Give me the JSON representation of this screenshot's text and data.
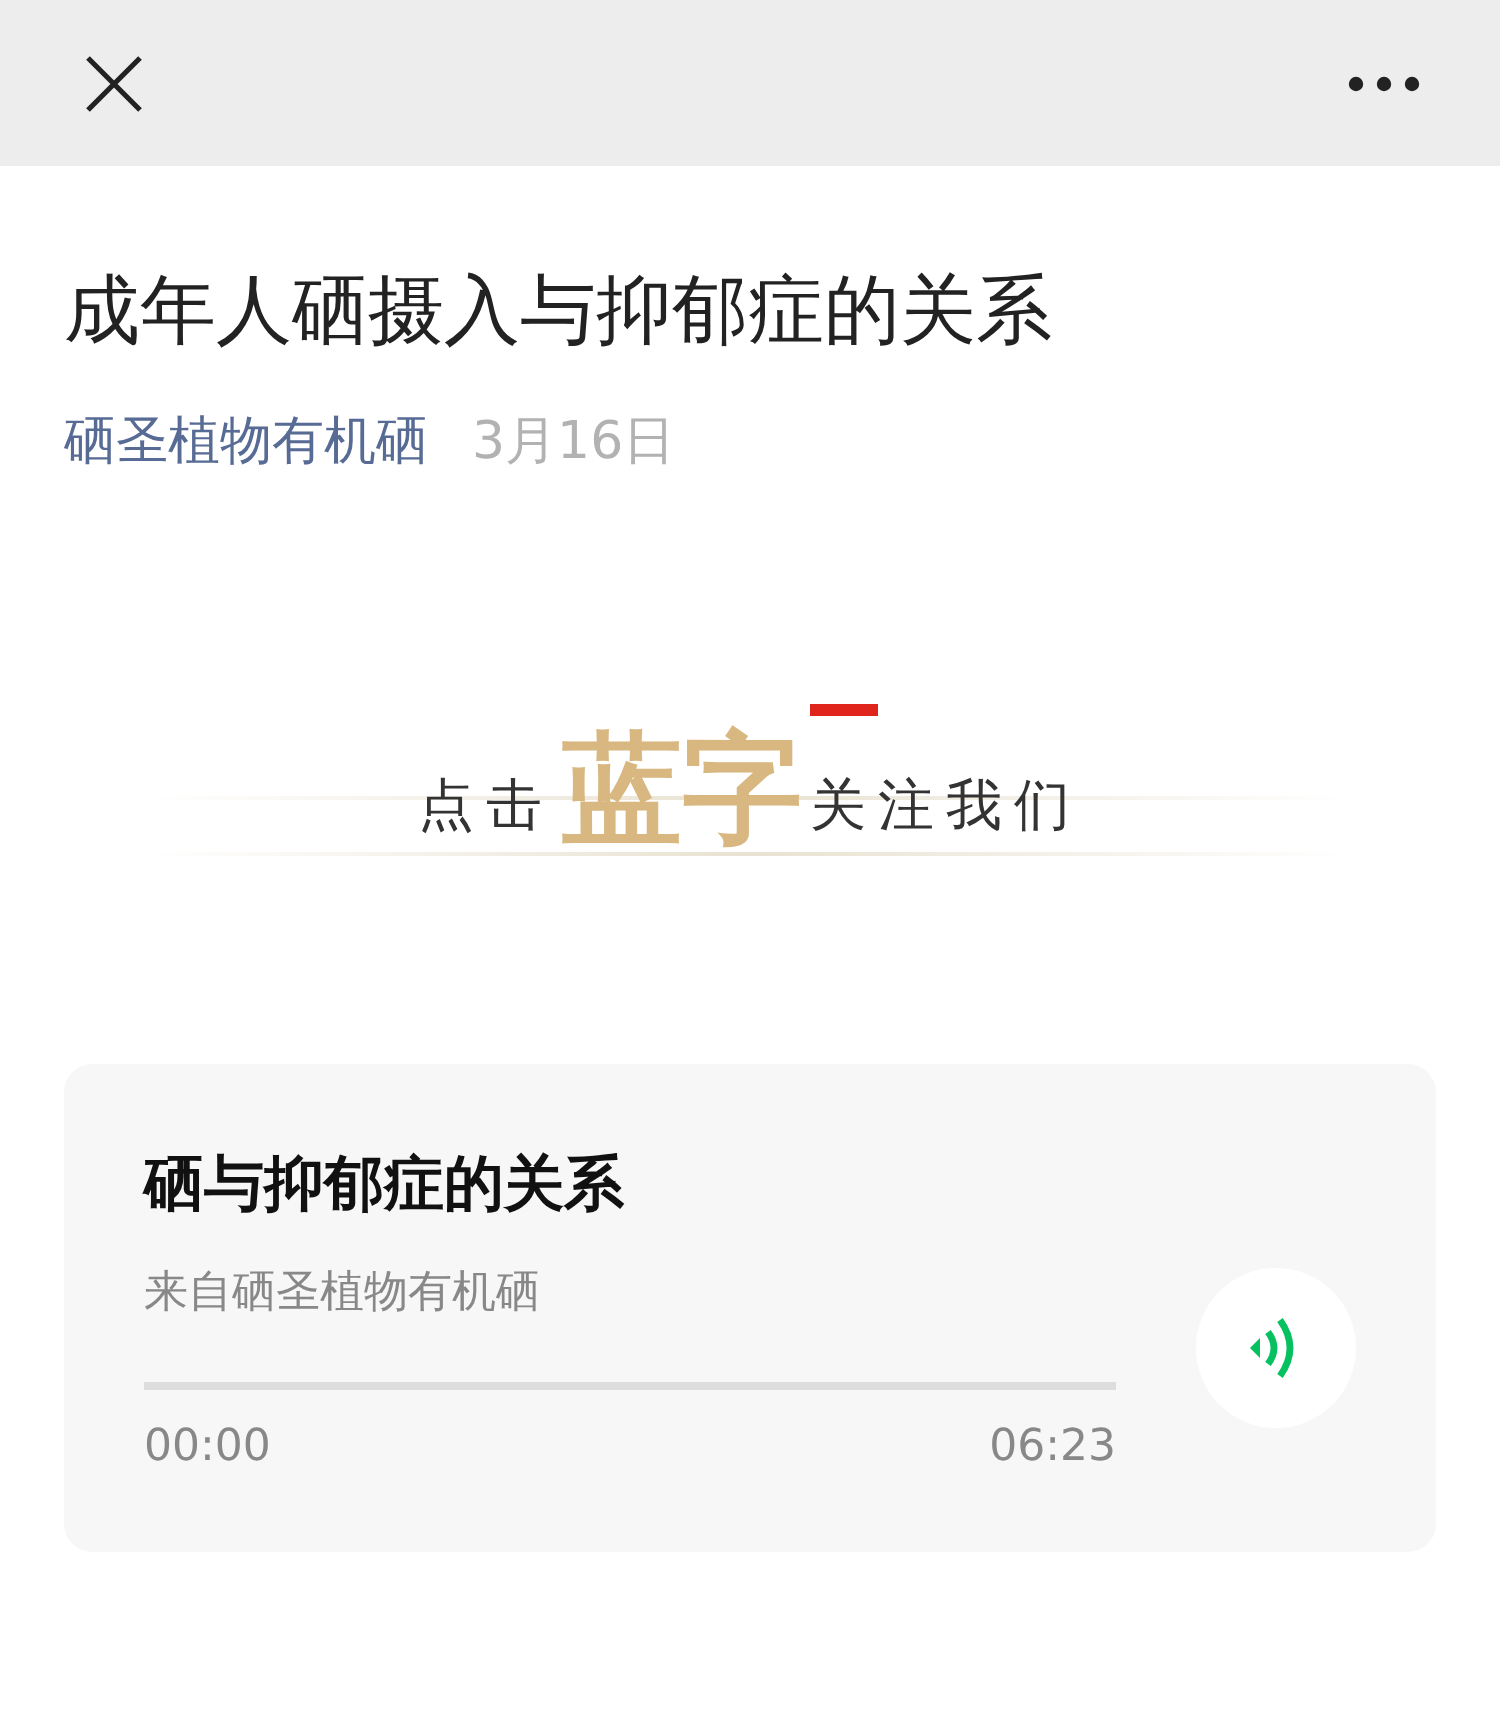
{
  "article": {
    "title": "成年人硒摄入与抑郁症的关系",
    "account": "硒圣植物有机硒",
    "date": "3月16日"
  },
  "banner": {
    "before": "点击",
    "highlight": "蓝字",
    "after": "关注我们"
  },
  "audio": {
    "title": "硒与抑郁症的关系",
    "source": "来自硒圣植物有机硒",
    "level": 0,
    "elapsed": "00:00",
    "duration": "06:23"
  }
}
